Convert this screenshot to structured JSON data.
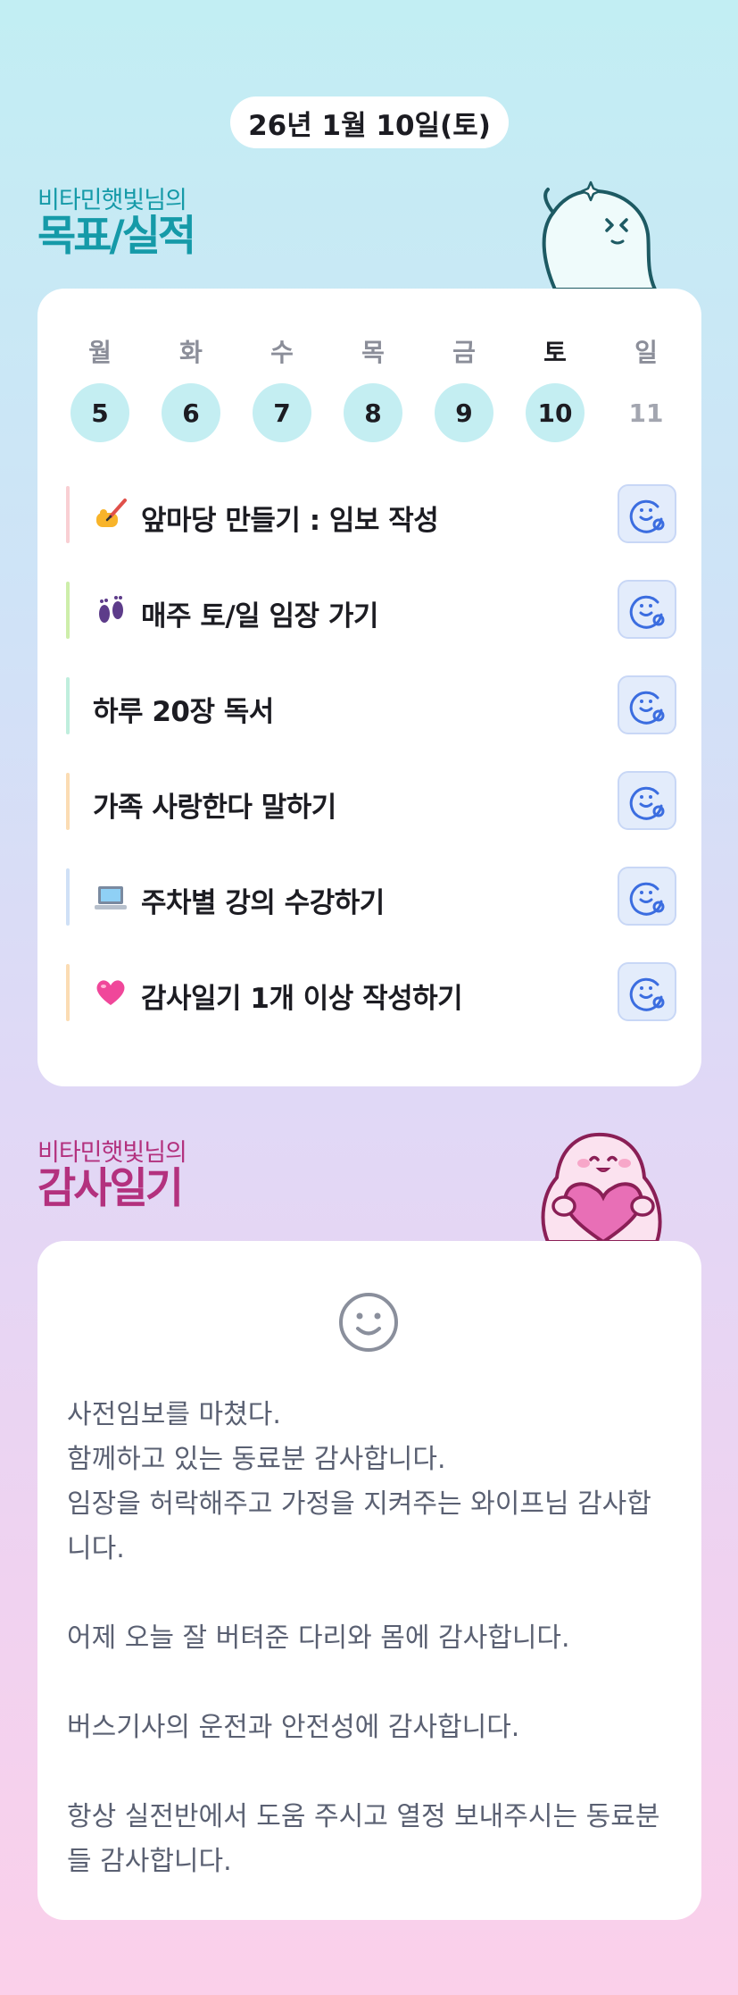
{
  "header": {
    "date": "26년 1월 10일(토)"
  },
  "goals_section": {
    "owner_label": "비타민햇빛님의",
    "title": "목표/실적",
    "week": [
      {
        "day": "월",
        "date": "5",
        "state": "done"
      },
      {
        "day": "화",
        "date": "6",
        "state": "done"
      },
      {
        "day": "수",
        "date": "7",
        "state": "done"
      },
      {
        "day": "목",
        "date": "8",
        "state": "done"
      },
      {
        "day": "금",
        "date": "9",
        "state": "done"
      },
      {
        "day": "토",
        "date": "10",
        "state": "today"
      },
      {
        "day": "일",
        "date": "11",
        "state": "future"
      }
    ],
    "goals": [
      {
        "emoji": "writing-hand-icon",
        "label": "앞마당 만들기 : 임보 작성",
        "color": "#f9cfd3"
      },
      {
        "emoji": "footprints-icon",
        "label": "매주 토/일 임장 가기",
        "color": "#cdeeaa"
      },
      {
        "emoji": "",
        "label": "하루 20장 독서",
        "color": "#bfeedd"
      },
      {
        "emoji": "",
        "label": "가족 사랑한다 말하기",
        "color": "#fbdcb3"
      },
      {
        "emoji": "laptop-icon",
        "label": "주차별 강의 수강하기",
        "color": "#cfe0f6"
      },
      {
        "emoji": "pink-heart-icon",
        "label": "감사일기 1개 이상 작성하기",
        "color": "#fbdcb3"
      }
    ]
  },
  "gratitude_section": {
    "owner_label": "비타민햇빛님의",
    "title": "감사일기",
    "text": "사전임보를 마쳤다.\n함께하고 있는 동료분 감사합니다.\n임장을 허락해주고 가정을 지켜주는 와이프님 감사합니다.\n\n어제 오늘 잘 버텨준 다리와 몸에 감사합니다.\n\n버스기사의 운전과 안전성에 감사합니다.\n\n항상 실전반에서 도움 주시고 열정 보내주시는 동료분들 감사합니다."
  },
  "colors": {
    "accent_teal": "#159aa8",
    "accent_pink": "#b3317e",
    "day_circle": "#c4eef2",
    "check_bg": "#e3ecfb",
    "check_icon": "#3b6de0"
  }
}
